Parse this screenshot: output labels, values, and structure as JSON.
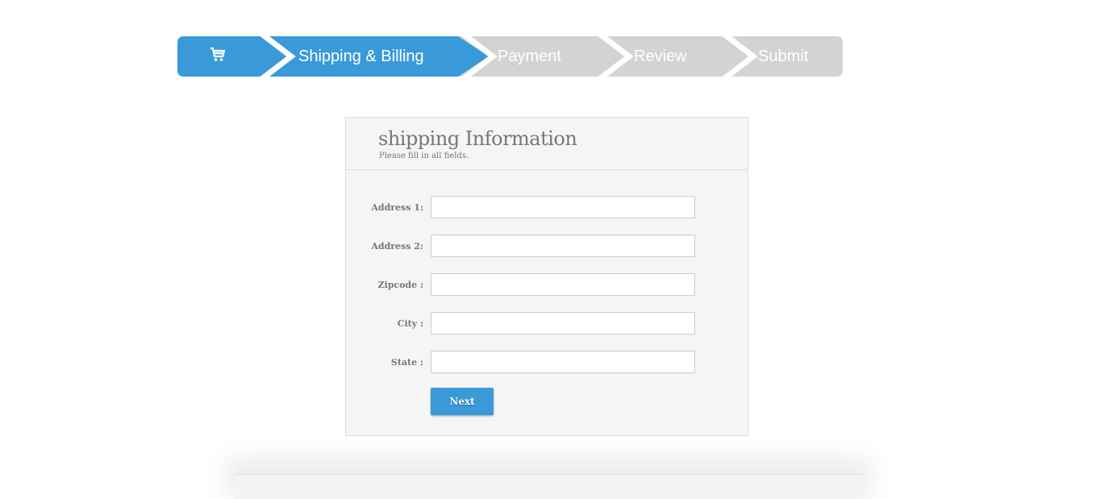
{
  "colors": {
    "active_step": "#3a9ad9",
    "inactive_step": "#d3d3d3",
    "card_background": "#f5f5f5",
    "button": "#3a9ad9",
    "label_text": "#777777"
  },
  "steps": {
    "cart": {
      "icon": "shopping-cart-icon"
    },
    "items": [
      {
        "label": "Shipping & Billing",
        "active": true
      },
      {
        "label": "Payment",
        "active": false
      },
      {
        "label": "Review",
        "active": false
      },
      {
        "label": "Submit",
        "active": false
      }
    ]
  },
  "form": {
    "title": "shipping Information",
    "subtitle": "Please fill in all fields.",
    "fields": [
      {
        "label": "Address 1:",
        "value": "",
        "placeholder": ""
      },
      {
        "label": "Address 2:",
        "value": "",
        "placeholder": ""
      },
      {
        "label": "Zipcode :",
        "value": "",
        "placeholder": ""
      },
      {
        "label": "City :",
        "value": "",
        "placeholder": ""
      },
      {
        "label": "State :",
        "value": "",
        "placeholder": ""
      }
    ],
    "next_label": "Next"
  }
}
